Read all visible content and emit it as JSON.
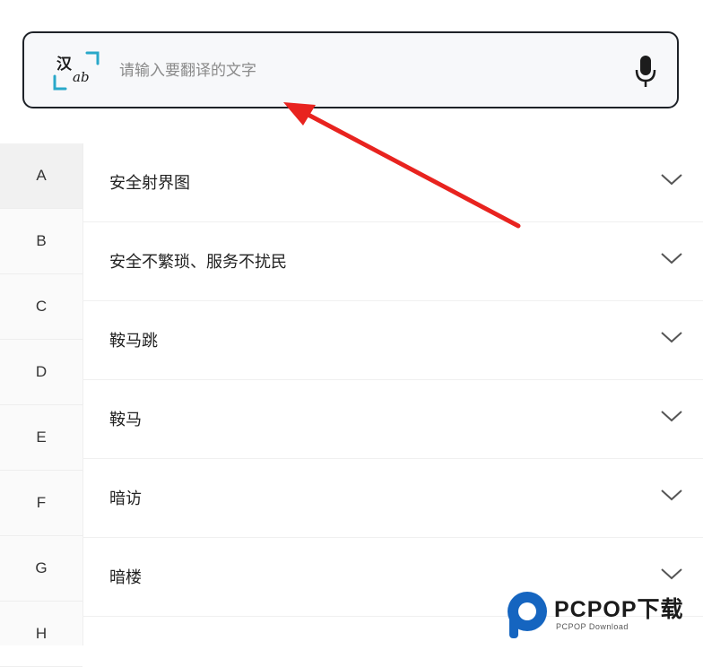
{
  "search": {
    "placeholder": "请输入要翻译的文字",
    "ocr_icon_text_top": "汉",
    "ocr_icon_text_bottom": "ab"
  },
  "index": {
    "letters": [
      "A",
      "B",
      "C",
      "D",
      "E",
      "F",
      "G",
      "H"
    ],
    "active": "A"
  },
  "terms": [
    {
      "label": "安全射界图"
    },
    {
      "label": "安全不繁琐、服务不扰民"
    },
    {
      "label": "鞍马跳"
    },
    {
      "label": "鞍马"
    },
    {
      "label": "暗访"
    },
    {
      "label": "暗楼"
    }
  ],
  "annotation": {
    "arrow_color": "#e8231f"
  },
  "watermark": {
    "brand": "PCPOP下载",
    "sub": "PCPOP Download",
    "accent_color": "#1565c0"
  }
}
